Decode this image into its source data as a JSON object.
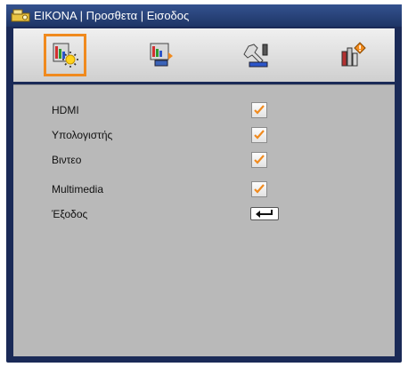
{
  "title": "ΕΙΚΟΝΑ | Προσθετα | Εισοδος",
  "tabs": [
    {
      "name": "image-settings",
      "active": true
    },
    {
      "name": "display",
      "active": false
    },
    {
      "name": "setup",
      "active": false
    },
    {
      "name": "options",
      "active": false
    }
  ],
  "rows": [
    {
      "label": "HDMI",
      "checked": true
    },
    {
      "label": "Υπολογιστής",
      "checked": true
    },
    {
      "label": "Βιντεο",
      "checked": true
    },
    {
      "label": "Multimedia",
      "checked": true
    },
    {
      "label": "Έξοδος",
      "control": "enter-key"
    }
  ],
  "colors": {
    "accent": "#f08a1e",
    "frame": "#1a2a57",
    "panel": "#b9b9b9"
  }
}
